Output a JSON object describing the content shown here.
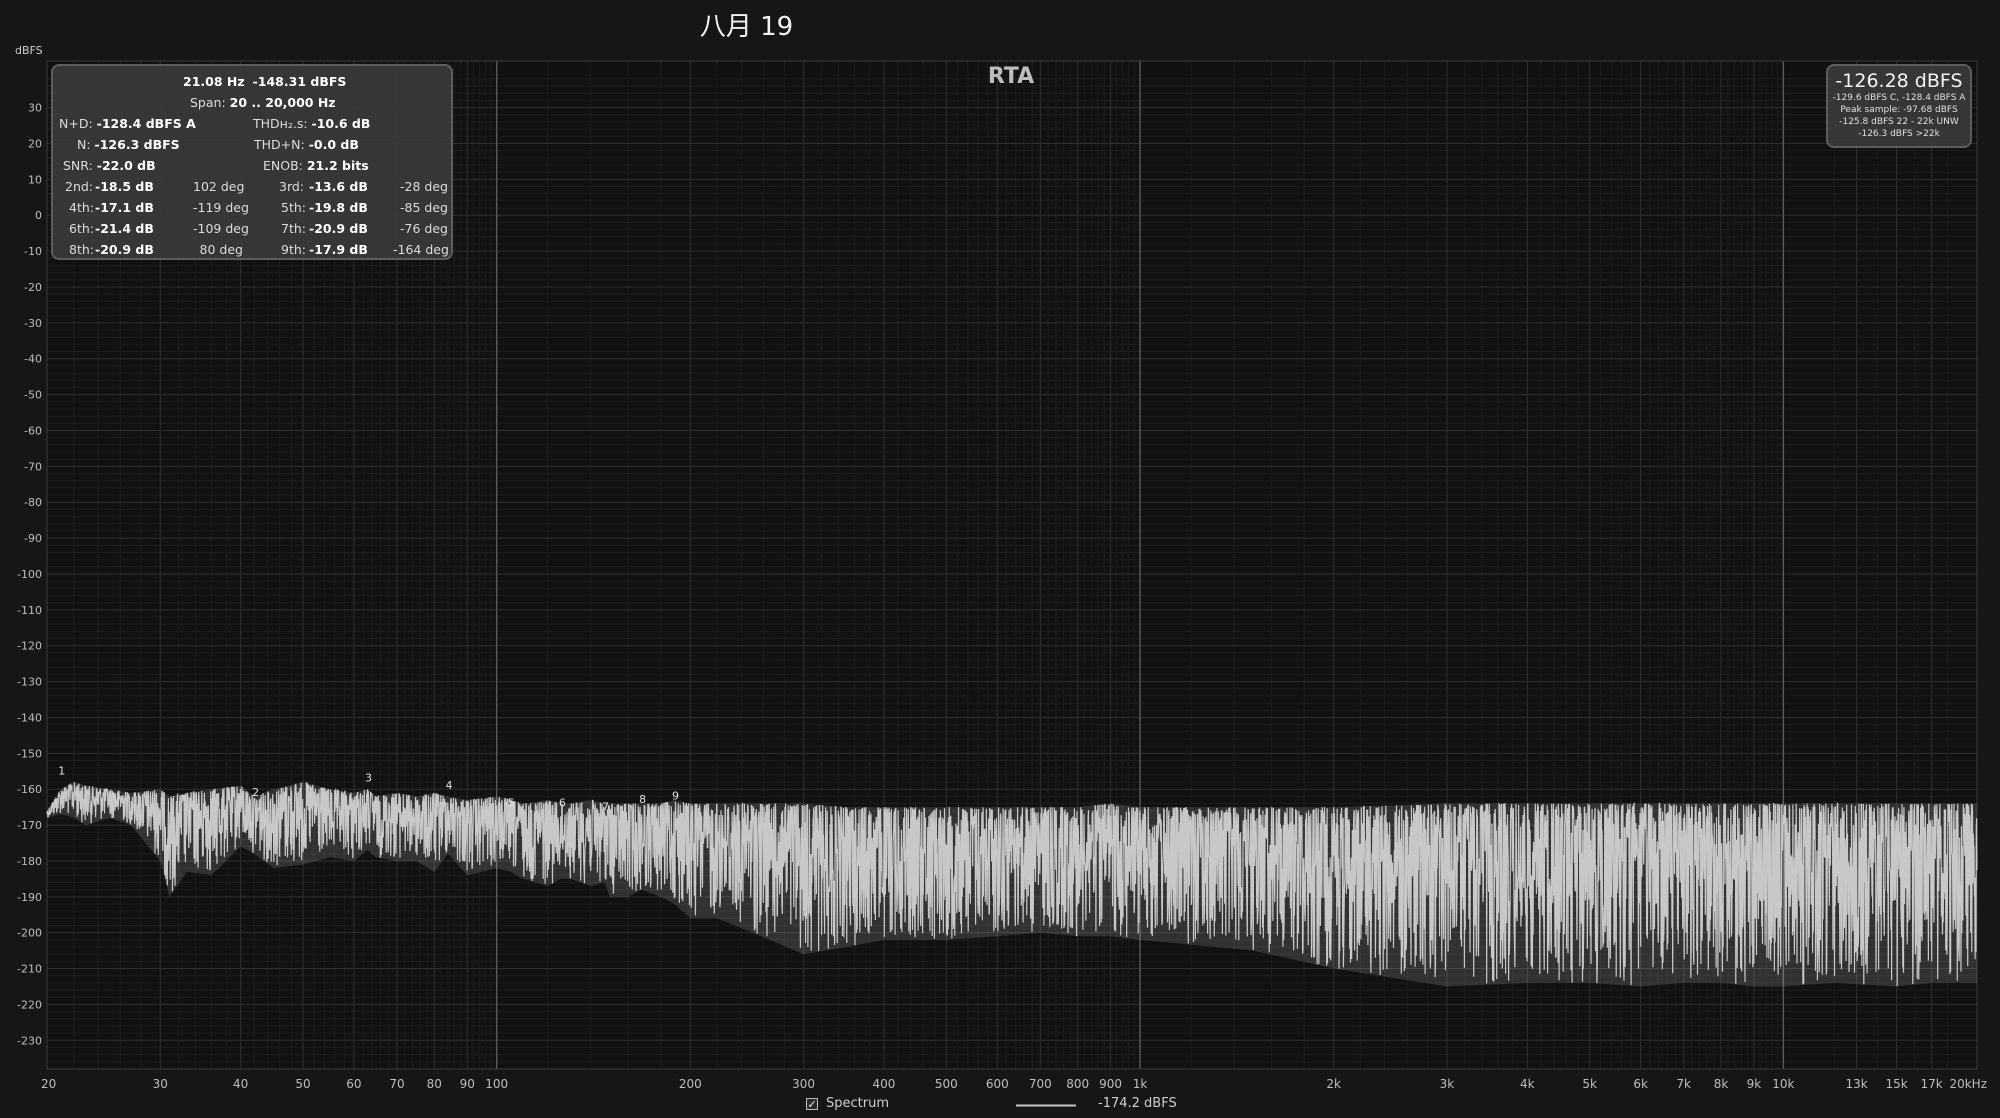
{
  "title": "八月 19",
  "chart_data": {
    "type": "line",
    "title": "RTA",
    "ylabel": "dBFS",
    "xscale": "log",
    "xlim": [
      20,
      20000
    ],
    "ylim": [
      -238,
      43
    ],
    "yticks": [
      30,
      20,
      10,
      0,
      -10,
      -20,
      -30,
      -40,
      -50,
      -60,
      -70,
      -80,
      -90,
      -100,
      -110,
      -120,
      -130,
      -140,
      -150,
      -160,
      -170,
      -180,
      -190,
      -200,
      -210,
      -220,
      -230
    ],
    "xticks": [
      {
        "v": 20,
        "label": "20"
      },
      {
        "v": 30,
        "label": "30"
      },
      {
        "v": 40,
        "label": "40"
      },
      {
        "v": 50,
        "label": "50"
      },
      {
        "v": 60,
        "label": "60"
      },
      {
        "v": 70,
        "label": "70"
      },
      {
        "v": 80,
        "label": "80"
      },
      {
        "v": 90,
        "label": "90"
      },
      {
        "v": 100,
        "label": "100"
      },
      {
        "v": 200,
        "label": "200"
      },
      {
        "v": 300,
        "label": "300"
      },
      {
        "v": 400,
        "label": "400"
      },
      {
        "v": 500,
        "label": "500"
      },
      {
        "v": 600,
        "label": "600"
      },
      {
        "v": 700,
        "label": "700"
      },
      {
        "v": 800,
        "label": "800"
      },
      {
        "v": 900,
        "label": "900"
      },
      {
        "v": 1000,
        "label": "1k"
      },
      {
        "v": 2000,
        "label": "2k"
      },
      {
        "v": 3000,
        "label": "3k"
      },
      {
        "v": 4000,
        "label": "4k"
      },
      {
        "v": 5000,
        "label": "5k"
      },
      {
        "v": 6000,
        "label": "6k"
      },
      {
        "v": 7000,
        "label": "7k"
      },
      {
        "v": 8000,
        "label": "8k"
      },
      {
        "v": 9000,
        "label": "9k"
      },
      {
        "v": 10000,
        "label": "10k"
      },
      {
        "v": 13000,
        "label": "13k"
      },
      {
        "v": 15000,
        "label": "15k"
      },
      {
        "v": 17000,
        "label": "17k"
      },
      {
        "v": 20000,
        "label": "20kHz"
      }
    ],
    "series": [
      {
        "name": "Spectrum",
        "color": "#c8c8c8",
        "x": [
          20,
          21,
          22,
          23,
          25,
          27,
          30,
          31,
          33,
          36,
          40,
          42,
          45,
          50,
          55,
          60,
          63,
          65,
          70,
          75,
          80,
          84,
          90,
          100,
          105,
          110,
          120,
          126,
          130,
          140,
          147,
          150,
          160,
          168,
          180,
          189,
          200,
          220,
          250,
          300,
          350,
          400,
          500,
          600,
          700,
          800,
          900,
          1000,
          1500,
          2000,
          3000,
          4000,
          5000,
          6000,
          7000,
          8000,
          9000,
          10000,
          12000,
          15000,
          17000,
          20000
        ],
        "upper": [
          -166,
          -160,
          -158,
          -159,
          -160,
          -161,
          -160,
          -162,
          -161,
          -160,
          -159,
          -162,
          -160,
          -158,
          -160,
          -161,
          -160,
          -162,
          -161,
          -162,
          -161,
          -162,
          -163,
          -162,
          -163,
          -164,
          -163,
          -164,
          -164,
          -163,
          -164,
          -164,
          -164,
          -164,
          -164,
          -163,
          -164,
          -164,
          -164,
          -164,
          -165,
          -165,
          -165,
          -165,
          -165,
          -165,
          -164,
          -165,
          -165,
          -165,
          -164,
          -164,
          -164,
          -164,
          -164,
          -164,
          -164,
          -164,
          -164,
          -164,
          -164,
          -164
        ],
        "lower": [
          -168,
          -167,
          -168,
          -170,
          -168,
          -170,
          -180,
          -190,
          -183,
          -184,
          -176,
          -178,
          -182,
          -181,
          -179,
          -180,
          -177,
          -179,
          -180,
          -180,
          -183,
          -178,
          -184,
          -182,
          -183,
          -185,
          -187,
          -185,
          -185,
          -187,
          -186,
          -190,
          -190,
          -188,
          -190,
          -192,
          -196,
          -196,
          -200,
          -206,
          -204,
          -202,
          -202,
          -201,
          -200,
          -201,
          -201,
          -202,
          -205,
          -210,
          -215,
          -214,
          -214,
          -215,
          -214,
          -214,
          -215,
          -215,
          -214,
          -215,
          -214,
          -214
        ],
        "markers": [
          {
            "label": "1",
            "x": 21.08,
            "y": -157
          },
          {
            "label": "2",
            "x": 42.2,
            "y": -163
          },
          {
            "label": "3",
            "x": 63.2,
            "y": -159
          },
          {
            "label": "4",
            "x": 84.3,
            "y": -161
          },
          {
            "label": "5",
            "x": 105.4,
            "y": -166
          },
          {
            "label": "6",
            "x": 126.5,
            "y": -166
          },
          {
            "label": "7",
            "x": 147.6,
            "y": -167
          },
          {
            "label": "8",
            "x": 168.6,
            "y": -165
          },
          {
            "label": "9",
            "x": 189.7,
            "y": -164
          }
        ]
      }
    ]
  },
  "stats": {
    "cursor": "21.08 Hz",
    "cursor_level": "-148.31 dBFS",
    "span_label": "Span:",
    "span": "20 .. 20,000 Hz",
    "nd_label": "N+D:",
    "nd": "-128.4 dBFS A",
    "thd_label": "THDн₂.s:",
    "thd": "-10.6 dB",
    "n_label": "N:",
    "n": "-126.3 dBFS",
    "thdn_label": "THD+N:",
    "thdn": "-0.0 dB",
    "snr_label": "SNR:",
    "snr": "-22.0 dB",
    "enob_label": "ENOB:",
    "enob": "21.2 bits",
    "harmonics": [
      {
        "label": "2nd:",
        "db": "-18.5 dB",
        "deg": "102 deg"
      },
      {
        "label": "3rd:",
        "db": "-13.6 dB",
        "deg": "-28 deg"
      },
      {
        "label": "4th:",
        "db": "-17.1 dB",
        "deg": "-119 deg"
      },
      {
        "label": "5th:",
        "db": "-19.8 dB",
        "deg": "-85 deg"
      },
      {
        "label": "6th:",
        "db": "-21.4 dB",
        "deg": "-109 deg"
      },
      {
        "label": "7th:",
        "db": "-20.9 dB",
        "deg": "-76 deg"
      },
      {
        "label": "8th:",
        "db": "-20.9 dB",
        "deg": "80 deg"
      },
      {
        "label": "9th:",
        "db": "-17.9 dB",
        "deg": "-164 deg"
      }
    ]
  },
  "peak": {
    "main": "-126.28 dBFS",
    "line1": "-129.6 dBFS C, -128.4 dBFS A",
    "line2": "Peak sample: -97.68 dBFS",
    "line3": "-125.8 dBFS 22 - 22k UNW",
    "line4": "-126.3 dBFS >22k"
  },
  "legend": {
    "checkbox": "✓",
    "series_label": "Spectrum",
    "value": "-174.2 dBFS"
  }
}
